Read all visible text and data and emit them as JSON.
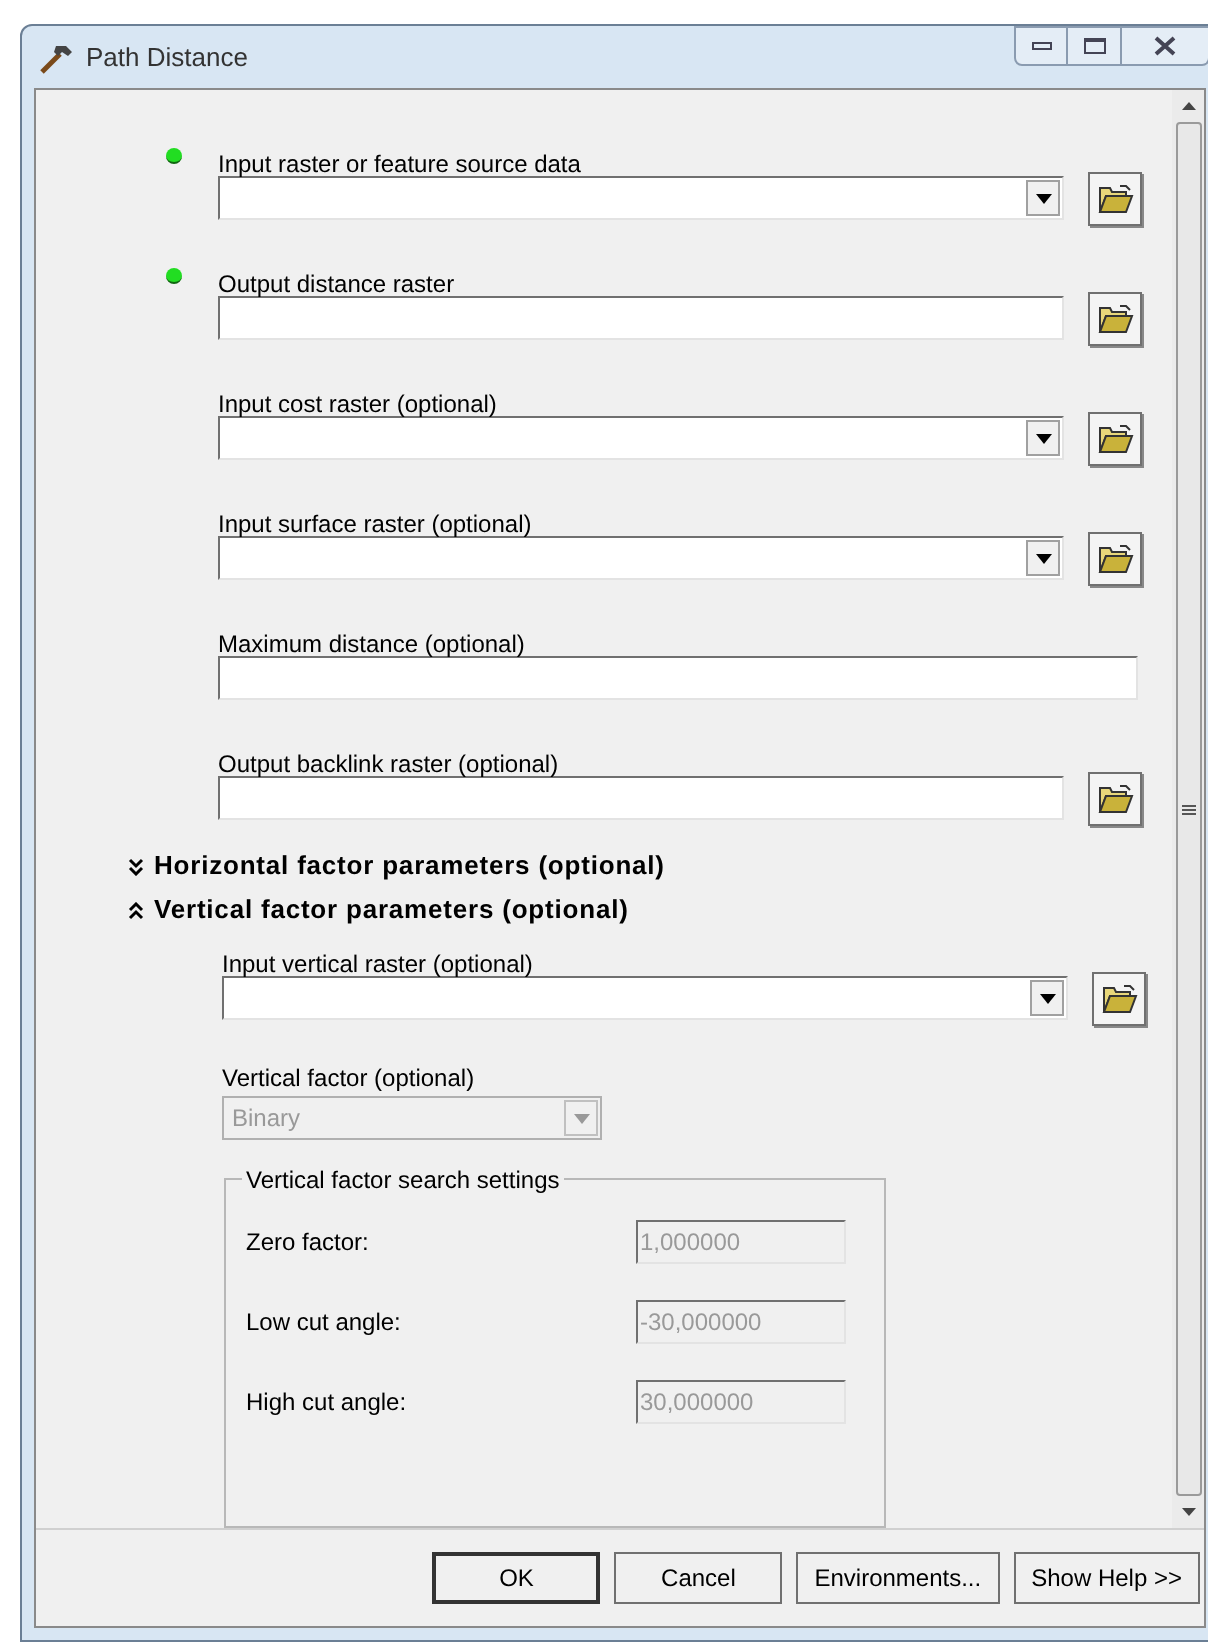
{
  "window": {
    "title": "Path Distance"
  },
  "parameters": [
    {
      "label": "Input raster or feature source data",
      "kind": "combo",
      "required": true,
      "browse": true
    },
    {
      "label": "Output distance raster",
      "kind": "text",
      "required": true,
      "browse": true
    },
    {
      "label": "Input cost raster (optional)",
      "kind": "combo",
      "required": false,
      "browse": true
    },
    {
      "label": "Input surface raster (optional)",
      "kind": "combo",
      "required": false,
      "browse": true
    },
    {
      "label": "Maximum distance (optional)",
      "kind": "text",
      "required": false,
      "browse": false
    },
    {
      "label": "Output backlink raster (optional)",
      "kind": "text",
      "required": false,
      "browse": true
    }
  ],
  "sections": [
    {
      "title": "Horizontal factor parameters (optional)",
      "expanded": false
    },
    {
      "title": "Vertical factor parameters (optional)",
      "expanded": true,
      "parameters": [
        {
          "label": "Input vertical raster (optional)",
          "kind": "combo",
          "required": false,
          "browse": true
        }
      ],
      "factor": {
        "label": "Vertical factor (optional)",
        "value": "Binary",
        "disabled": true
      },
      "group": {
        "title": "Vertical factor search settings",
        "rows": [
          {
            "label": "Zero factor:",
            "value": "1,000000",
            "disabled": true
          },
          {
            "label": "Low cut angle:",
            "value": "-30,000000",
            "disabled": true
          },
          {
            "label": "High cut angle:",
            "value": "30,000000",
            "disabled": true
          }
        ]
      }
    }
  ],
  "buttons": [
    {
      "label": "OK",
      "default": true
    },
    {
      "label": "Cancel",
      "default": false
    },
    {
      "label": "Environments...",
      "default": false
    },
    {
      "label": "Show Help >>",
      "default": false
    }
  ]
}
